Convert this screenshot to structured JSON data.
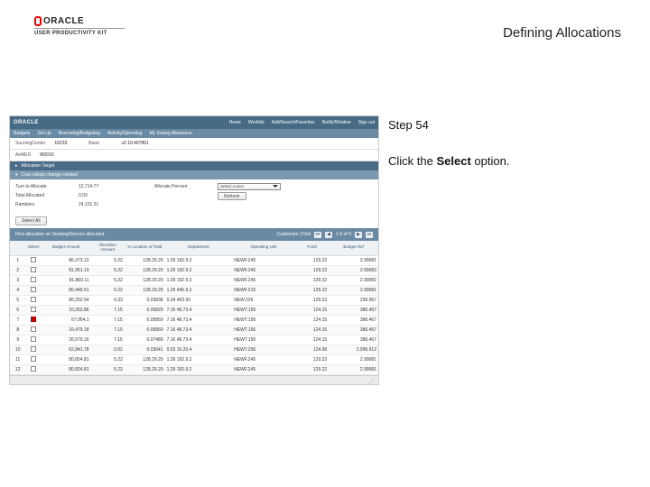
{
  "header": {
    "brand_name": "ORACLE",
    "brand_sub": "USER PRODUCTIVITY KIT",
    "page_title": "Defining Allocations"
  },
  "instructions": {
    "step_label": "Step 54",
    "line1_pre": "Click the ",
    "line1_bold": "Select",
    "line1_post": " option."
  },
  "app": {
    "topbar_brand": "ORACLE",
    "topbar_links": [
      "Home",
      "Worklist",
      "Add/Search/Favorites",
      "Notify/Window",
      "Sign out"
    ],
    "menubar": [
      "Budgets",
      "Set Up",
      "Borrowing/Budgeting",
      "Activity/Spending",
      "My Saving Allowance"
    ],
    "panel1": [
      {
        "lbl": "SunningCenter",
        "val": "16233"
      },
      {
        "lbl": "Basic",
        "val": ""
      },
      {
        "lbl": "v2.10.407851",
        "val": ""
      }
    ],
    "panel1b": {
      "lbl": "AirMED",
      "val": "M2010"
    },
    "bands": {
      "alloc_target": "Allocation Target",
      "cost_rollups": "Cost rollups change created"
    },
    "form": {
      "rows": [
        {
          "lbl": "Turn to Allocate",
          "val": "12,714.77",
          "extra_lbl": "Allocate Percent"
        },
        {
          "lbl": "Total Allocated",
          "val": "0.00"
        },
        {
          "lbl": "Ramblers",
          "val": "24,101.31"
        }
      ],
      "select_value": "Select Action",
      "select_btns": [
        "Refresh"
      ]
    },
    "btn_row": {
      "btn": "Select All"
    },
    "grid_band": {
      "title": "First allocation on Sunning/Service allocated",
      "customize": "Customize | Find",
      "pager": "1-9 of 9"
    },
    "grid": {
      "headers": [
        "",
        "Select",
        "Budget Amount",
        "Allocation Amount",
        "% Location of Total",
        "Department",
        "Operating Unit",
        "Fund",
        "Budget Ref"
      ],
      "rows": [
        [
          "1",
          "",
          "86,373.12",
          "5.22",
          "128.29.29",
          "1.29 192.9.2",
          "NEWF.245",
          "129.22",
          "2.99081"
        ],
        [
          "2",
          "",
          "81,951.19",
          "5.22",
          "128.29.29",
          "1.29 192.9.2",
          "NEWF.245",
          "129.22",
          "2.99082"
        ],
        [
          "3",
          "",
          "81,869.11",
          "5.22",
          "128.29.29",
          "1.29 192.9.2",
          "NEWF.245",
          "129.22",
          "2.99082"
        ],
        [
          "4",
          "",
          "80,449.51",
          "5.22",
          "128.29.29",
          "1.29 445.9.2",
          "NEWF.216",
          "129.22",
          "2.99081"
        ],
        [
          "5",
          "",
          "80,252.54",
          "0.33",
          "0.03838",
          "0.34 463.93",
          "NEW.236",
          "129.22",
          "299.967"
        ],
        [
          "6",
          "",
          "10,353.86",
          "7.15",
          "0.05829",
          "7.16 48.73.4",
          "HEWT.156",
          "124.15",
          "386.467"
        ],
        [
          "7",
          "X",
          "67,954.1",
          "7.15",
          "0.05859",
          "7.16 48.73.4",
          "HEWT.156",
          "124.15",
          "386.467"
        ],
        [
          "8",
          "",
          "10,479.18",
          "7.15",
          "0.05869",
          "7.16 48.73.4",
          "HEWT.156",
          "124.15",
          "386.467"
        ],
        [
          "9",
          "",
          "26,579.16",
          "7.15",
          "0.07489",
          "7.16 48.73.4",
          "HEWT.156",
          "124.15",
          "386.467"
        ],
        [
          "10",
          "",
          "62,841.78",
          "0.02",
          "0.03041",
          "0.03 16.20.4",
          "HEWT.256",
          "124.98",
          "2.996.912"
        ],
        [
          "11",
          "",
          "80,824.81",
          "5.22",
          "128.29.29",
          "1.29 192.9.2",
          "NEWF.245",
          "129.22",
          "2.99081"
        ],
        [
          "12",
          "",
          "80,824.81",
          "5.22",
          "128.29.29",
          "1.29 192.9.2",
          "NEWF.245",
          "129.22",
          "2.99081"
        ]
      ]
    }
  }
}
